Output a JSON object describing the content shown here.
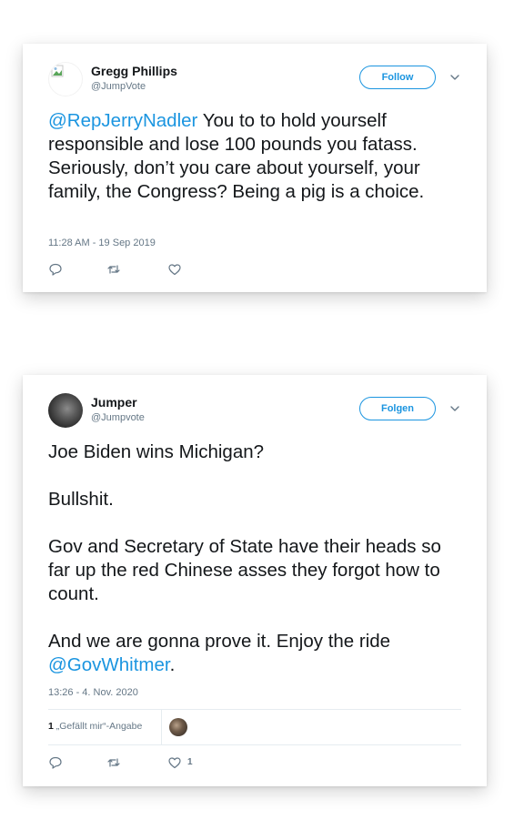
{
  "tweets": [
    {
      "display_name": "Gregg Phillips",
      "handle": "@JumpVote",
      "follow_label": "Follow",
      "mention": "@RepJerryNadler",
      "body": " You to to hold yourself responsible and lose 100 pounds you fatass. Seriously, don’t you care about yourself, your family, the Congress? Being a pig is a choice.",
      "timestamp": "11:28 AM - 19 Sep 2019"
    },
    {
      "display_name": "Jumper",
      "handle": "@Jumpvote",
      "follow_label": "Folgen",
      "paragraphs": [
        "Joe Biden wins Michigan?",
        "Bullshit.",
        "Gov and Secretary of State have their heads so far up the red Chinese asses they forgot how to count."
      ],
      "last_text": "And we are gonna prove it. Enjoy the ride ",
      "last_mention": "@GovWhitmer",
      "last_suffix": ".",
      "timestamp": "13:26 - 4. Nov. 2020",
      "likes_count": "1",
      "likes_label": "„Gefällt mir“-Angabe",
      "like_count_action": "1"
    }
  ],
  "icons": [
    "broken-image-icon",
    "chevron-down-icon",
    "reply-icon",
    "retweet-icon",
    "like-icon"
  ],
  "colors": {
    "accent": "#1b95e0",
    "text": "#14171a",
    "secondary": "#657786",
    "border": "#e6ecf0"
  }
}
